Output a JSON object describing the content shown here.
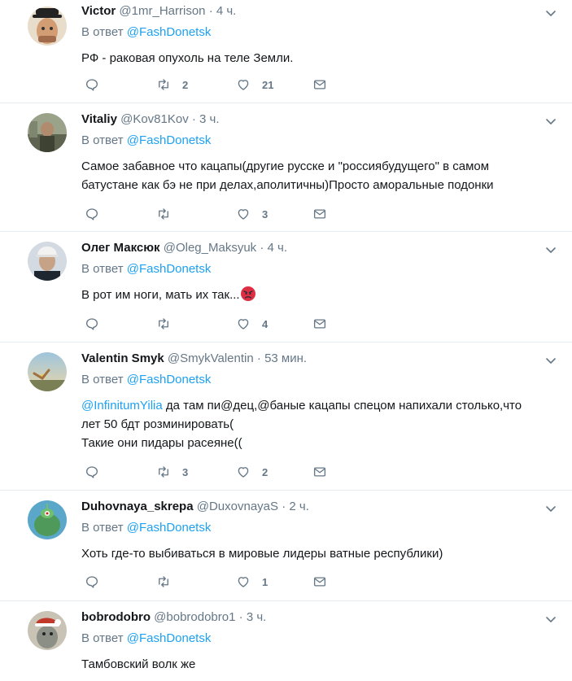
{
  "reply_prefix": "В ответ",
  "tweets": [
    {
      "name": "Victor",
      "handle": "@1mr_Harrison",
      "time": "4 ч.",
      "reply_to": "@FashDonetsk",
      "lines": [
        "РФ - раковая опухоль на теле Земли."
      ],
      "retweets": "2",
      "likes": "21",
      "avatar_color": "#c9a37a"
    },
    {
      "name": "Vitaliy",
      "handle": "@Kov81Kov",
      "time": "3 ч.",
      "reply_to": "@FashDonetsk",
      "lines": [
        "Самое забавное что кацапы(другие русске и \"россиябудущего\" в самом",
        "батустане как бэ не при делах,аполитичны)Просто аморальные подонки"
      ],
      "retweets": "",
      "likes": "3",
      "avatar_color": "#6f7a62"
    },
    {
      "name": "Олег Максюк",
      "handle": "@Oleg_Maksyuk",
      "time": "4 ч.",
      "reply_to": "@FashDonetsk",
      "text_prefix": "В рот им ноги, мать их так...",
      "emoji": "angry-face-emoji",
      "retweets": "",
      "likes": "4",
      "avatar_color": "#2c3848"
    },
    {
      "name": "Valentin Smyk",
      "handle": "@SmykValentin",
      "time": "53 мин.",
      "reply_to": "@FashDonetsk",
      "mention": "@InfinitumYilia",
      "first_line_rest": " да там пи@дец,@баные кацапы спецом напихали столько,что",
      "lines": [
        "лет 50 бдт розминировать(",
        "Такие они пидары расеяне(("
      ],
      "retweets": "3",
      "likes": "2",
      "avatar_color": "#8fb3c9"
    },
    {
      "name": "Duhovnaya_skrepa",
      "handle": "@DuxovnayaS",
      "time": "2 ч.",
      "reply_to": "@FashDonetsk",
      "lines": [
        "Хоть где-то выбиваться в мировые лидеры ватные республики)"
      ],
      "retweets": "",
      "likes": "1",
      "avatar_color": "#3f7d4a"
    },
    {
      "name": "bobrodobro",
      "handle": "@bobrodobro1",
      "time": "3 ч.",
      "reply_to": "@FashDonetsk",
      "lines": [
        "Тамбовский волк же"
      ],
      "retweets": "",
      "likes": "",
      "avatar_color": "#b8b2a6"
    }
  ],
  "colors": {
    "link": "#1da1f2",
    "muted": "#657786",
    "text": "#14171a",
    "divider": "#e6ecf0"
  },
  "icons": [
    "reply-icon",
    "retweet-icon",
    "like-icon",
    "direct-message-icon",
    "chevron-down-icon"
  ]
}
